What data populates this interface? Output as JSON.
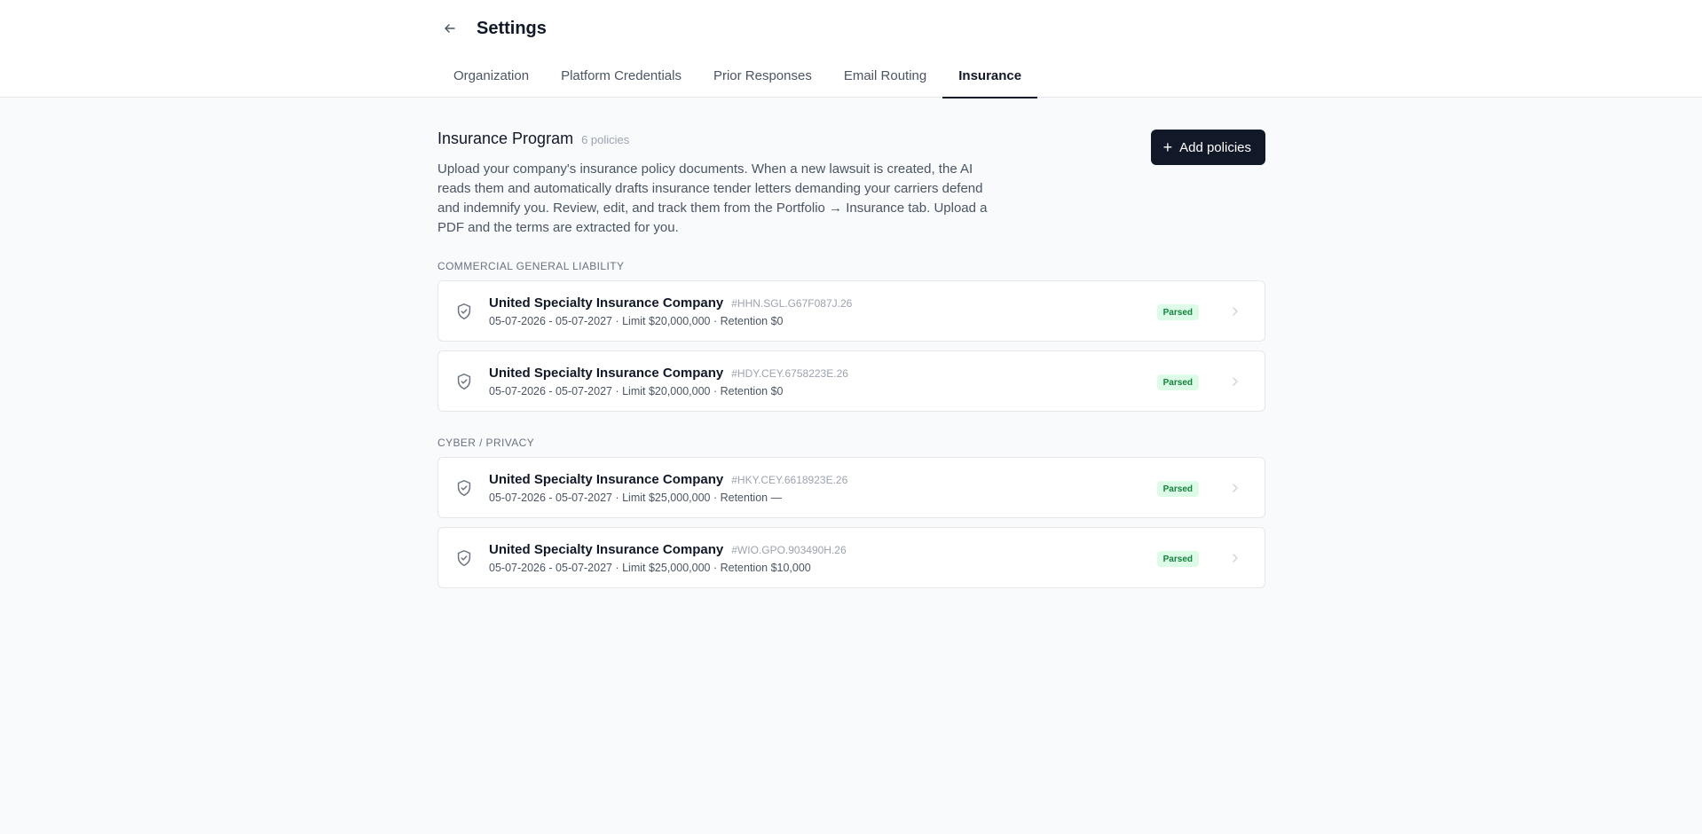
{
  "header": {
    "title": "Settings",
    "tabs": [
      {
        "label": "Organization",
        "active": false
      },
      {
        "label": "Platform Credentials",
        "active": false
      },
      {
        "label": "Prior Responses",
        "active": false
      },
      {
        "label": "Email Routing",
        "active": false
      },
      {
        "label": "Insurance",
        "active": true
      }
    ]
  },
  "insurance": {
    "title": "Insurance Program",
    "count": "6 policies",
    "add_button": "Add policies",
    "description": "Upload your company's insurance policy documents. When a new lawsuit is created, the AI reads them and automatically drafts insurance tender letters demanding your carriers defend and indemnify you. Review, edit, and track them from the Portfolio → Insurance tab. Upload a PDF and the terms are extracted for you.",
    "groups": [
      {
        "label": "Commercial General Liability",
        "policies": [
          {
            "carrier": "United Specialty Insurance Company",
            "number": "#HHN.SGL.G67F087J.26",
            "details": "05-07-2026 - 05-07-2027 · Limit $20,000,000 · Retention $0",
            "status": "Parsed"
          },
          {
            "carrier": "United Specialty Insurance Company",
            "number": "#HDY.CEY.6758223E.26",
            "details": "05-07-2026 - 05-07-2027 · Limit $20,000,000 · Retention $0",
            "status": "Parsed"
          }
        ]
      },
      {
        "label": "Cyber / Privacy",
        "policies": [
          {
            "carrier": "United Specialty Insurance Company",
            "number": "#HKY.CEY.6618923E.26",
            "details": "05-07-2026 - 05-07-2027 · Limit $25,000,000 · Retention —",
            "status": "Parsed"
          },
          {
            "carrier": "United Specialty Insurance Company",
            "number": "#WIO.GPO.903490H.26",
            "details": "05-07-2026 - 05-07-2027 · Limit $25,000,000 · Retention $10,000",
            "status": "Parsed"
          }
        ]
      }
    ]
  },
  "colors": {
    "primary_button": "#111827",
    "badge_bg": "#dcfce7",
    "badge_text": "#15803d",
    "page_bg": "#f8fafc"
  },
  "icons": {
    "back": "arrow-left-icon",
    "policy": "shield-check-icon",
    "row_action": "chevron-right-icon",
    "add": "plus-icon"
  }
}
